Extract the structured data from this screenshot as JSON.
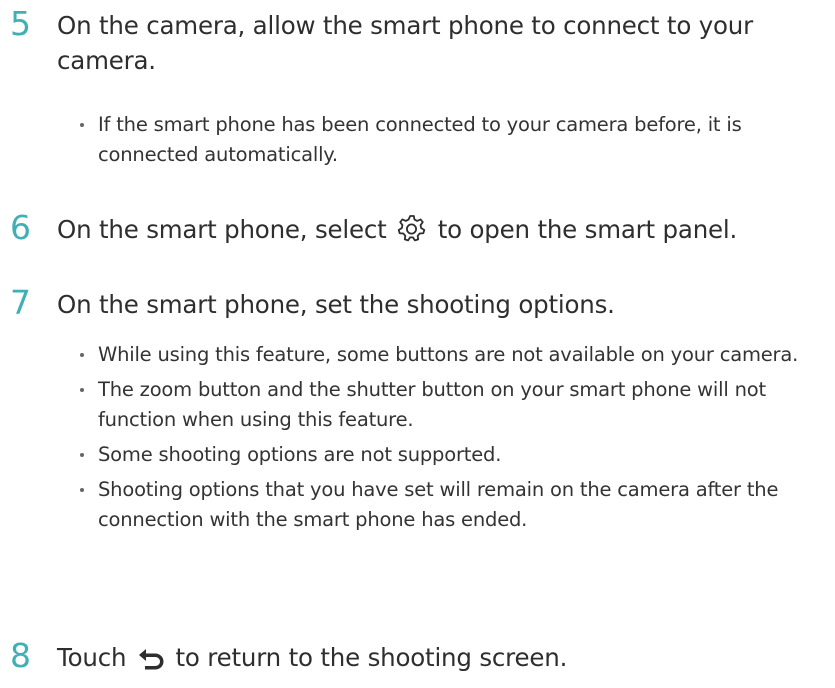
{
  "steps": [
    {
      "number": "5",
      "text": "On the camera, allow the smart phone to connect to your camera.",
      "bullets": [
        "If the smart phone has been connected to your camera before, it is connected automatically."
      ]
    },
    {
      "number": "6",
      "text_before_icon": "On the smart phone, select",
      "icon": "gear-icon",
      "text_after_icon": "to open the smart panel.",
      "bullets": []
    },
    {
      "number": "7",
      "text": "On the smart phone, set the shooting options.",
      "bullets": [
        "While using this feature, some buttons are not available on your camera.",
        "The zoom button and the shutter button on your smart phone will not function when using this feature.",
        "Some shooting options are not supported.",
        "Shooting options that you have set will remain on the camera after the connection with the smart phone has ended."
      ]
    },
    {
      "number": "8",
      "text_before_icon": "Touch",
      "icon": "back-arrow-icon",
      "text_after_icon": "to return to the shooting screen.",
      "bullets": []
    }
  ],
  "colors": {
    "step_number": "#3fb0b3",
    "text": "#2e2e2e"
  }
}
